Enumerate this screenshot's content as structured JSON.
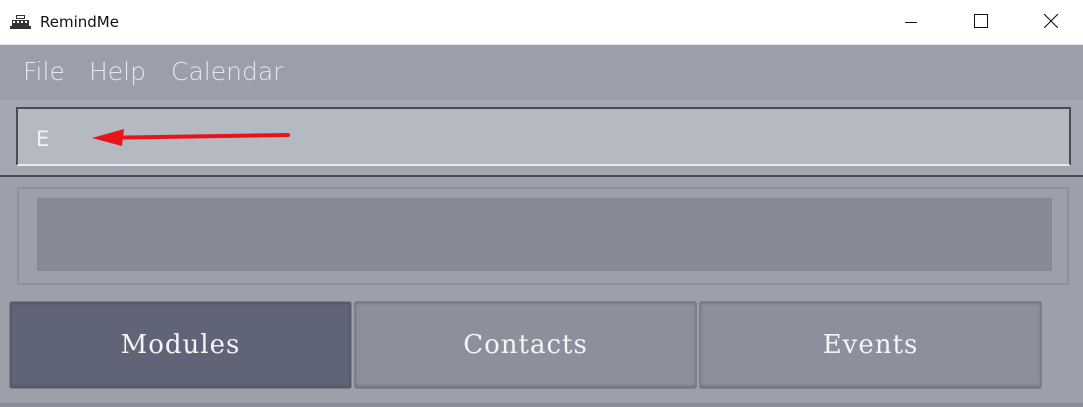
{
  "window": {
    "title": "RemindMe",
    "icon": "calendar-app-icon",
    "controls": {
      "minimize": "minimize-icon",
      "maximize": "maximize-icon",
      "close": "close-icon"
    }
  },
  "menu": {
    "items": [
      {
        "label": "File"
      },
      {
        "label": "Help"
      },
      {
        "label": "Calendar"
      }
    ]
  },
  "command_box": {
    "value": "E",
    "annotation": "red-arrow-pointing-left",
    "annotation_color": "#e8141c"
  },
  "result_display": {
    "text": ""
  },
  "tabs": {
    "items": [
      {
        "label": "Modules",
        "selected": true
      },
      {
        "label": "Contacts",
        "selected": false
      },
      {
        "label": "Events",
        "selected": false
      }
    ]
  },
  "colors": {
    "selected_tab": "#5f6476",
    "tab": "#8c909d",
    "menu_text": "#e6e8ee",
    "background": "#9ca0ab"
  }
}
